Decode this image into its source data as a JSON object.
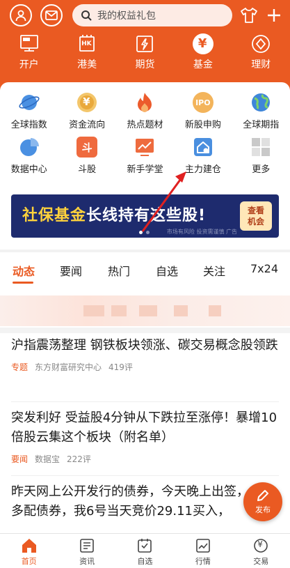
{
  "search": {
    "placeholder": "我的权益礼包"
  },
  "header_nav": [
    {
      "label": "开户",
      "icon": "open-account-icon"
    },
    {
      "label": "港美",
      "icon": "hk-us-icon"
    },
    {
      "label": "期货",
      "icon": "futures-icon"
    },
    {
      "label": "基金",
      "icon": "fund-icon"
    },
    {
      "label": "理财",
      "icon": "wealth-icon"
    }
  ],
  "grid": [
    {
      "label": "全球指数",
      "icon": "planet-icon"
    },
    {
      "label": "资金流向",
      "icon": "money-flow-icon"
    },
    {
      "label": "热点题材",
      "icon": "flame-icon"
    },
    {
      "label": "新股申购",
      "icon": "ipo-icon"
    },
    {
      "label": "全球期指",
      "icon": "globe-icon"
    },
    {
      "label": "数据中心",
      "icon": "pie-chart-icon"
    },
    {
      "label": "斗股",
      "icon": "battle-icon"
    },
    {
      "label": "新手学堂",
      "icon": "trend-board-icon"
    },
    {
      "label": "主力建仓",
      "icon": "house-icon"
    },
    {
      "label": "更多",
      "icon": "more-grid-icon"
    }
  ],
  "ipo_badge": "IPO",
  "hk_badge": "HK",
  "fund_symbol": "¥",
  "fight_symbol": "斗",
  "banner": {
    "headline_yellow": "社保基金",
    "headline_white": "长线持有这些股!",
    "cta_line1": "查看",
    "cta_line2": "机会",
    "note": "市场有风险 投资需谨慎 广告"
  },
  "tabs": [
    "动态",
    "要闻",
    "热门",
    "自选",
    "关注",
    "7x24"
  ],
  "news": [
    {
      "title": "沪指震荡整理 钢铁板块领涨、碳交易概念股领跌",
      "tag": "专题",
      "source": "东方财富研究中心",
      "comments": "419评"
    },
    {
      "title": "突发利好 受益股4分钟从下跌拉至涨停！暴增10倍股云集这个板块（附名单）",
      "tag": "要闻",
      "source": "数据宝",
      "comments": "222评"
    },
    {
      "title": "昨天网上公开发行的债券，今天晚上出签，中了多配债券，我6号当天竞价29.11买入，"
    }
  ],
  "fab": {
    "label": "发布"
  },
  "bottom_nav": [
    {
      "label": "首页",
      "icon": "home-icon",
      "active": true
    },
    {
      "label": "资讯",
      "icon": "news-icon"
    },
    {
      "label": "自选",
      "icon": "watchlist-icon"
    },
    {
      "label": "行情",
      "icon": "market-icon"
    },
    {
      "label": "交易",
      "icon": "trade-icon"
    }
  ],
  "colors": {
    "brand": "#ea5a22",
    "banner_bg": "#1e2b6e",
    "accent_yellow": "#ffd23c",
    "annotation_red": "#e02020"
  }
}
